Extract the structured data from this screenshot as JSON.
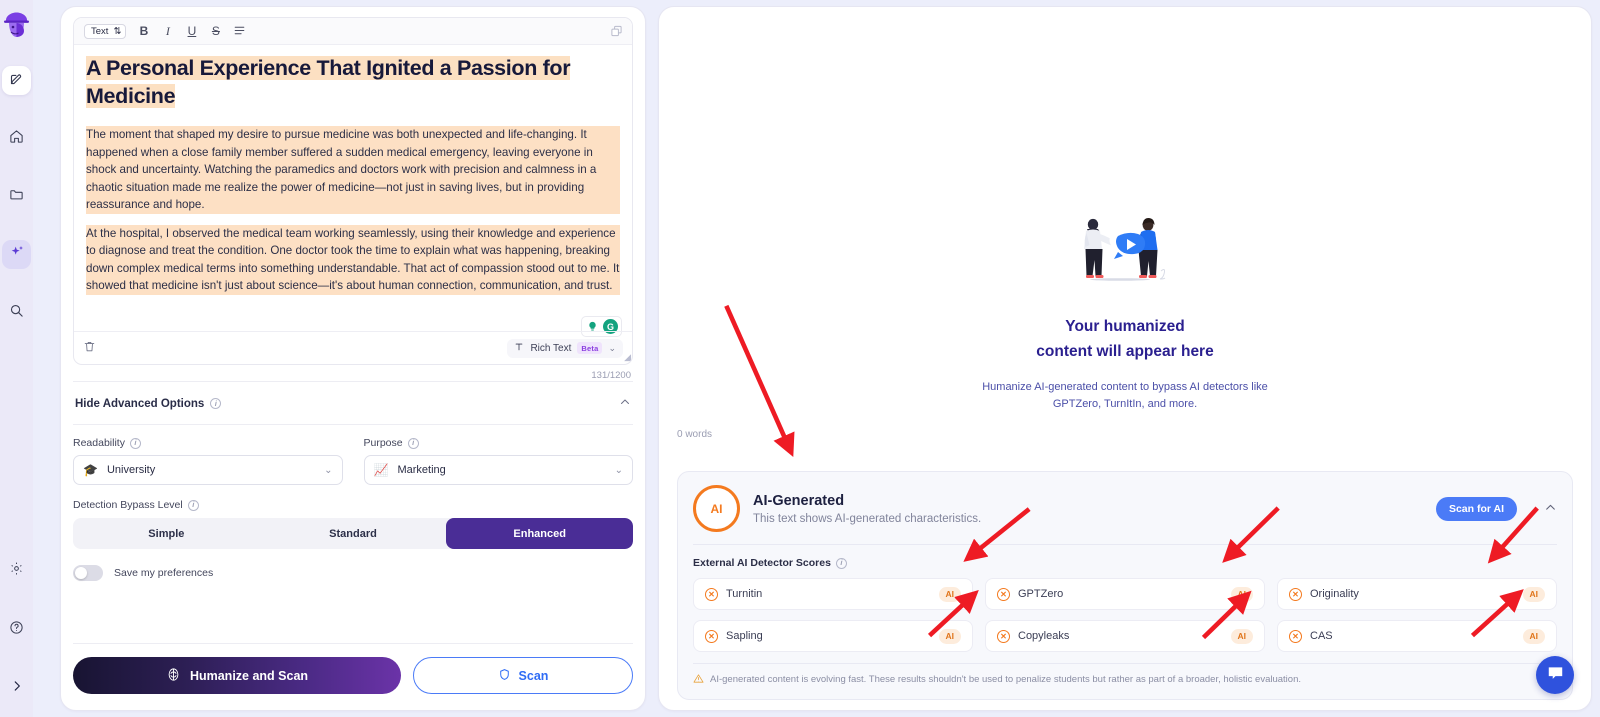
{
  "sidebar": {
    "logo_name": "app-logo-detective",
    "items": [
      {
        "name": "editor",
        "icon": "pencil-square-icon",
        "state": "active-white"
      },
      {
        "name": "home",
        "icon": "home-icon",
        "state": "plain"
      },
      {
        "name": "folder",
        "icon": "folder-icon",
        "state": "plain"
      },
      {
        "name": "ai-tools",
        "icon": "sparkles-icon",
        "state": "active-lavender"
      },
      {
        "name": "search",
        "icon": "search-icon",
        "state": "plain"
      }
    ],
    "bottom_items": [
      {
        "name": "settings",
        "icon": "gear-icon"
      },
      {
        "name": "help",
        "icon": "question-circle-icon"
      },
      {
        "name": "expand-sidebar",
        "icon": "chevron-right-icon"
      }
    ]
  },
  "editor": {
    "toolbar": {
      "style_select": "Text",
      "bold": "B",
      "italic": "I",
      "underline": "U",
      "strikethrough": "S",
      "list": "list-icon",
      "copy": "copy-icon"
    },
    "title": "A Personal Experience That Ignited a Passion for Medicine",
    "paragraphs": [
      "The moment that shaped my desire to pursue medicine was both unexpected and life-changing. It happened when a close family member suffered a sudden medical emergency, leaving everyone in shock and uncertainty. Watching the paramedics and doctors work with precision and calmness in a chaotic situation made me realize the power of medicine—not just in saving lives, but in providing reassurance and hope.",
      "At the hospital, I observed the medical team working seamlessly, using their knowledge and experience to diagnose and treat the condition. One doctor took the time to explain what was happening, breaking down complex medical terms into something understandable. That act of compassion stood out to me. It showed that medicine isn't just about science—it's about human connection, communication, and trust."
    ],
    "footer": {
      "delete_icon": "trash-icon",
      "rich_text_label": "Rich Text",
      "beta_label": "Beta",
      "char_count": "131/1200"
    },
    "grammarly": {
      "bulb": "lightbulb-icon",
      "logo": "G"
    }
  },
  "advanced": {
    "header_label": "Hide Advanced Options",
    "readability": {
      "label": "Readability",
      "value": "University",
      "icon": "graduation-cap-icon"
    },
    "purpose": {
      "label": "Purpose",
      "value": "Marketing",
      "icon": "chart-icon"
    },
    "bypass": {
      "label": "Detection Bypass Level",
      "options": [
        "Simple",
        "Standard",
        "Enhanced"
      ],
      "selected": "Enhanced"
    },
    "save_prefs": {
      "label": "Save my preferences",
      "enabled": false
    }
  },
  "actions": {
    "primary_label": "Humanize and Scan",
    "primary_icon": "brain-icon",
    "secondary_label": "Scan",
    "secondary_icon": "shield-icon"
  },
  "output": {
    "empty_heading_line1": "Your humanized",
    "empty_heading_line2": "content will appear here",
    "empty_sub": "Humanize AI-generated content to bypass AI detectors like GPTZero, TurnItIn, and more.",
    "word_count": "0 words",
    "illustration": "two-people-with-play-button-illustration"
  },
  "result": {
    "ring_label": "AI",
    "title": "AI-Generated",
    "subtitle": "This text shows AI-generated characteristics.",
    "scan_button": "Scan for AI",
    "collapse_icon": "chevron-up-icon",
    "external_label": "External AI Detector Scores",
    "detectors": [
      {
        "name": "Turnitin",
        "badge": "AI"
      },
      {
        "name": "GPTZero",
        "badge": "AI"
      },
      {
        "name": "Originality",
        "badge": "AI"
      },
      {
        "name": "Sapling",
        "badge": "AI"
      },
      {
        "name": "Copyleaks",
        "badge": "AI"
      },
      {
        "name": "CAS",
        "badge": "AI"
      }
    ],
    "warning": "AI-generated content is evolving fast. These results shouldn't be used to penalize students but rather as part of a broader, holistic evaluation."
  },
  "chat": {
    "icon": "chat-bubble-icon"
  },
  "colors": {
    "accent_purple": "#4a2d96",
    "accent_blue": "#4b7bf7",
    "ai_orange": "#f47a1f",
    "highlight_orange": "#fde0c4",
    "highlight_blue": "#d9daf8",
    "page_bg": "#eceefb",
    "annotation_red": "#ee1b24"
  }
}
